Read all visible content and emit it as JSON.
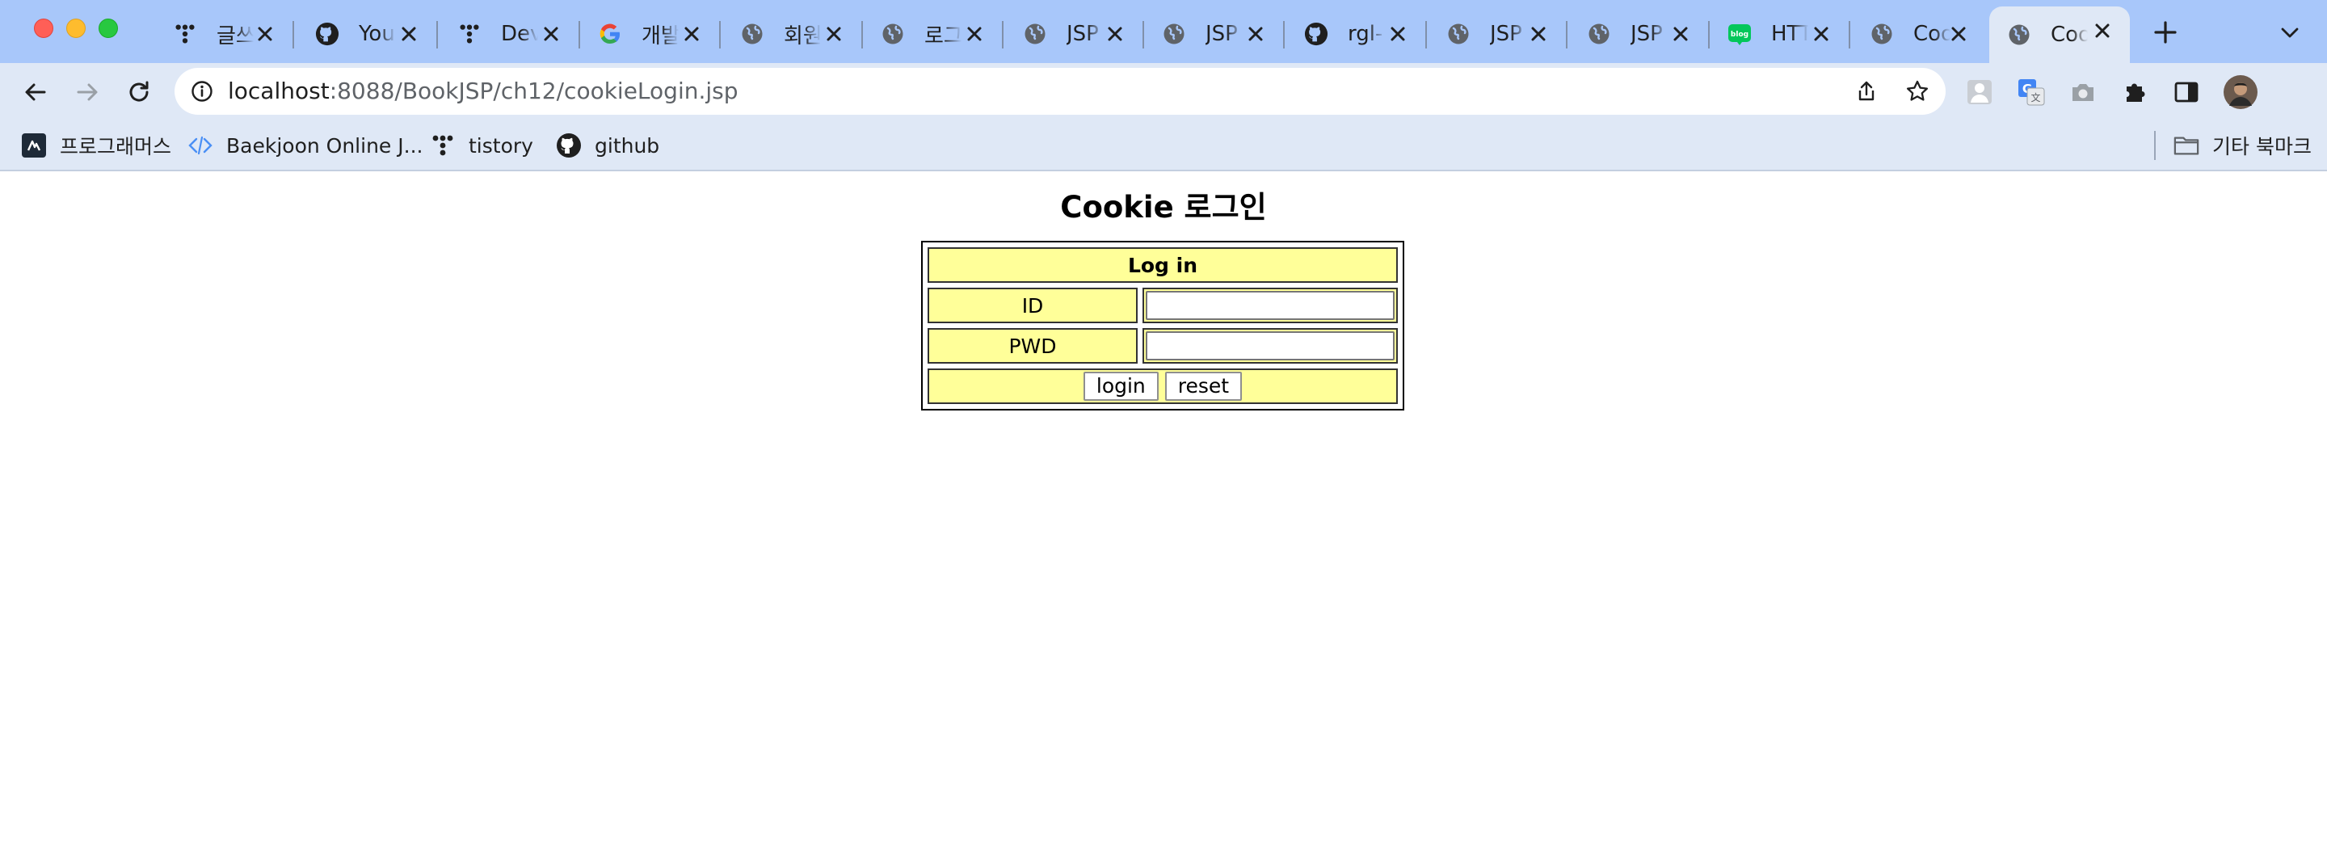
{
  "browser": {
    "tabs": [
      {
        "title": "글쓰기",
        "icon": "tistory-icon",
        "active": false
      },
      {
        "title": "Your",
        "icon": "github-icon",
        "active": false
      },
      {
        "title": "Devlog",
        "icon": "tistory-icon",
        "active": false
      },
      {
        "title": "개발자",
        "icon": "google-icon",
        "active": false
      },
      {
        "title": "회원가입",
        "icon": "globe-icon",
        "active": false
      },
      {
        "title": "로그인",
        "icon": "globe-icon",
        "active": false
      },
      {
        "title": "JSP",
        "icon": "globe-icon",
        "active": false
      },
      {
        "title": "JSP",
        "icon": "globe-icon",
        "active": false
      },
      {
        "title": "rgl-",
        "icon": "github-icon",
        "active": false
      },
      {
        "title": "JSP",
        "icon": "globe-icon",
        "active": false
      },
      {
        "title": "JSP",
        "icon": "globe-icon",
        "active": false
      },
      {
        "title": "HTTP",
        "icon": "naver-blog-icon",
        "active": false
      },
      {
        "title": "Cookie",
        "icon": "globe-icon",
        "active": false
      },
      {
        "title": "Cookie",
        "icon": "globe-icon",
        "active": true
      }
    ],
    "address": {
      "host": "localhost",
      "path": ":8088/BookJSP/ch12/cookieLogin.jsp"
    },
    "bookmarks": [
      {
        "label": "프로그래머스",
        "icon": "programmers-icon"
      },
      {
        "label": "Baekjoon Online J...",
        "icon": "baekjoon-icon"
      },
      {
        "label": "tistory",
        "icon": "tistory-icon"
      },
      {
        "label": "github",
        "icon": "github-icon"
      }
    ],
    "other_bookmarks": "기타 북마크",
    "colors": {
      "tabstrip": "#a8c7fa",
      "toolbar": "#dfe8f6",
      "active_tab": "#dfe8f6"
    }
  },
  "page": {
    "title": "Cookie 로그인",
    "form": {
      "header": "Log in",
      "id_label": "ID",
      "pwd_label": "PWD",
      "id_value": "",
      "pwd_value": "",
      "login_label": "login",
      "reset_label": "reset"
    },
    "colors": {
      "cell_bg": "#ffff99"
    }
  }
}
